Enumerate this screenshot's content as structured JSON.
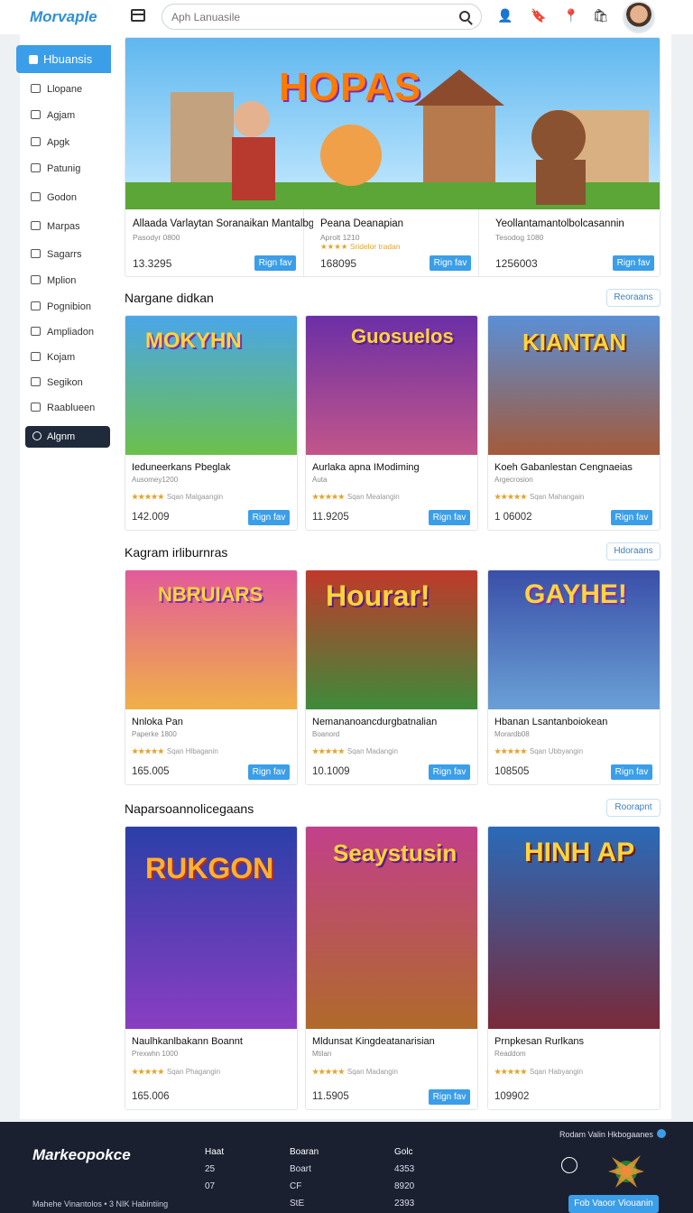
{
  "header": {
    "logo": "Morvaple",
    "search_placeholder": "Aph Lanuasile"
  },
  "sidebar": {
    "active": "Hbuansis",
    "items": [
      "Llopane",
      "Agjam",
      "Apgk",
      "Patunig",
      "Godon",
      "Marpas",
      "Sagarrs",
      "Mplion",
      "Pognibion",
      "Ampliadon",
      "Kojam",
      "Segikon",
      "Raablueen"
    ],
    "dark": "Algnm"
  },
  "hero": {
    "title_art": "HOPAS",
    "cards": [
      {
        "title": "Allaada Varlaytan Soranaikan Mantalbg",
        "sub": "Pasodyr 0800",
        "price": "13.3295",
        "btn": "Rign fav"
      },
      {
        "title": "Peana Deanapian",
        "sub": "Aprolt 1210",
        "stars": "★★★★ Sridelor tradan",
        "price": "168095",
        "btn": "Rign fav"
      },
      {
        "title": "Yeollantamantolbolcasannin",
        "sub": "Tesodog 1080",
        "price": "1256003",
        "btn": "Rign fav"
      }
    ]
  },
  "sections": [
    {
      "title": "Nargane didkan",
      "pill": "Reoraans",
      "cards": [
        {
          "art": "MOKYHN",
          "title": "Ieduneerkans Pbeglak",
          "sub": "Ausomey1200",
          "stars": "★★★★★",
          "stars_text": "Sqan Malgaangin",
          "price": "142.009",
          "btn": "Rign fav"
        },
        {
          "art": "Guosuelos",
          "title": "Aurlaka apna IModiming",
          "sub": "Auta",
          "stars": "★★★★★",
          "stars_text": "Sqan Mealangin",
          "price": "11.9205",
          "btn": "Rign fav"
        },
        {
          "art": "KIANTAN",
          "title": "Koeh Gabanlestan Cengnaeias",
          "sub": "Argecrosion",
          "stars": "★★★★★",
          "stars_text": "Sqan Mahangain",
          "price": "1 06002",
          "btn": "Rign fav"
        }
      ]
    },
    {
      "title": "Kagram irliburnras",
      "pill": "Hdoraans",
      "cards": [
        {
          "art": "NBRUIARS",
          "title": "Nnloka Pan",
          "sub": "Paperke 1800",
          "stars": "★★★★★",
          "stars_text": "Sqan Hlbaganin",
          "price": "165.005",
          "btn": "Rign fav"
        },
        {
          "art": "Hourar!",
          "title": "Nemananoancdurgbatnalian",
          "sub": "Boanord",
          "stars": "★★★★★",
          "stars_text": "Sqan Madangin",
          "price": "10.1009",
          "btn": "Rign fav"
        },
        {
          "art": "GAYHE!",
          "title": "Hbanan Lsantanboiokean",
          "sub": "Morardb08",
          "stars": "★★★★★",
          "stars_text": "Sqan Ubbyangin",
          "price": "108505",
          "btn": "Rign fav"
        }
      ]
    },
    {
      "title": "Naparsoannolicegaans",
      "pill": "Roorapnt",
      "cards": [
        {
          "art": "RUKGON",
          "title": "Naulhkanlbakann Boannt",
          "sub": "Prexwhn 1000",
          "stars": "★★★★★",
          "stars_text": "Sqan Phagangin",
          "price": "165.006",
          "btn": ""
        },
        {
          "art": "Seaystusin",
          "title": "Mldunsat Kingdeatanarisian",
          "sub": "Mtilan",
          "stars": "★★★★★",
          "stars_text": "Sqan Madangin",
          "price": "11.5905",
          "btn": "Rign fav"
        },
        {
          "art": "HINH AP",
          "title": "Prnpkesan Rurlkans",
          "sub": "Readdom",
          "stars": "★★★★★",
          "stars_text": "Sqan Habyangin",
          "price": "109902",
          "btn": ""
        }
      ]
    }
  ],
  "footer": {
    "logo": "Markeopokce",
    "copyright": "Mahehe Vinantolos • 3 NIK Habintiing",
    "cols": [
      {
        "head": "Haat",
        "rows": [
          "25",
          "07"
        ]
      },
      {
        "head": "Boaran",
        "rows": [
          "Boart",
          "CF",
          "StE"
        ]
      },
      {
        "head": "Golc",
        "rows": [
          "4353",
          "8920",
          "2393"
        ]
      }
    ],
    "news": "Rodam Valin Hkbogaanes",
    "button": "Fob Vaoor Viouanin"
  }
}
